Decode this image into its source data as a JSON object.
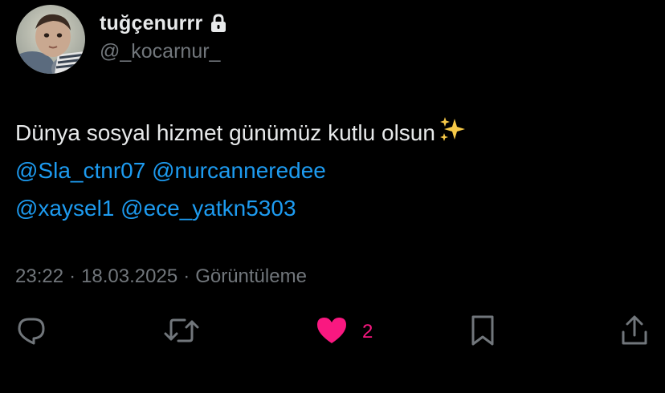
{
  "user": {
    "display_name": "tuğçenurrr",
    "handle": "@_kocarnur_",
    "avatar_icon": "child-avatar-photo",
    "lock_icon": "lock-icon"
  },
  "tweet": {
    "text_plain": "Dünya sosyal hizmet günümüz kutlu olsun",
    "emoji": "sparkles",
    "mentions": [
      "@Sla_ctnr07",
      "@nurcanneredee",
      "@xaysel1",
      "@ece_yatkn5303"
    ]
  },
  "meta": {
    "time": "23:22",
    "date": "18.03.2025",
    "views_label": "Görüntüleme",
    "separator": "·"
  },
  "actions": {
    "reply_icon": "reply-icon",
    "retweet_icon": "retweet-icon",
    "like_icon": "heart-icon",
    "like_count": "2",
    "bookmark_icon": "bookmark-icon",
    "share_icon": "share-icon"
  },
  "colors": {
    "background": "#000000",
    "text": "#e7e9ea",
    "secondary": "#71767b",
    "mention": "#1d9bf0",
    "like": "#f91880"
  }
}
